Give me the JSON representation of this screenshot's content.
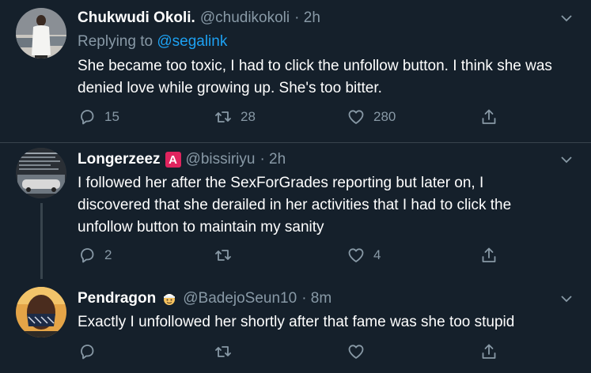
{
  "colors": {
    "background": "#15202b",
    "secondary_text": "#8899a6",
    "link": "#1da1f2",
    "divider": "#38444d"
  },
  "tweets": [
    {
      "name": "Chukwudi Okoli.",
      "handle": "@chudikokoli",
      "time": "· 2h",
      "replying_prefix": "Replying to",
      "replying_to": "@segalink",
      "text": "She became too toxic, I had to click the unfollow button. I think she was denied love while growing up. She's too bitter.",
      "replies": "15",
      "retweets": "28",
      "likes": "280"
    },
    {
      "name": "Longerzeez",
      "badge": "A",
      "handle": "@bissiriyu",
      "time": "· 2h",
      "text": "I followed her after the SexForGrades reporting but later on, I discovered that she derailed in her activities that I had to click the unfollow button to maintain my sanity",
      "replies": "2",
      "retweets": "",
      "likes": "4"
    },
    {
      "name": "Pendragon",
      "handle": "@BadejoSeun10",
      "time": "· 8m",
      "text": "Exactly I unfollowed her shortly after that fame was she too stupid",
      "replies": "",
      "retweets": "",
      "likes": ""
    }
  ],
  "icons": {
    "reply": "reply-icon",
    "retweet": "retweet-icon",
    "like": "heart-icon",
    "share": "share-icon",
    "more": "chevron-down-icon"
  }
}
